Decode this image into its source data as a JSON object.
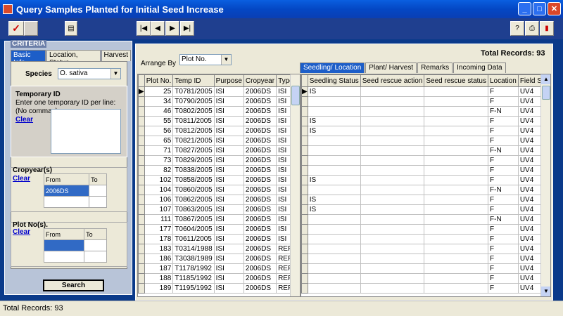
{
  "window": {
    "title": "Query Samples Planted for Initial Seed Increase"
  },
  "criteria": {
    "legend": "CRITERIA",
    "tabs": [
      "Basic Info",
      "Location, Status",
      "Harvest"
    ],
    "species_label": "Species",
    "species_value": "O. sativa",
    "temp_id": {
      "title": "Temporary ID",
      "hint1": "Enter one temporary ID per line:",
      "hint2": "(No commas)",
      "clear": "Clear"
    },
    "cropyear": {
      "title": "Cropyear(s)",
      "clear": "Clear",
      "from": "From",
      "to": "To",
      "from_value": "2006DS"
    },
    "plotno": {
      "title": "Plot No(s).",
      "clear": "Clear",
      "from": "From",
      "to": "To"
    },
    "search": "Search"
  },
  "results": {
    "arrange_by_label": "Arrange By",
    "arrange_by_value": "Plot No.",
    "total_records": "Total Records: 93",
    "tabs": [
      "Seedling/ Location",
      "Plant/ Harvest",
      "Remarks",
      "Incoming Data"
    ],
    "left_columns": [
      "Plot No.",
      "Temp ID",
      "Purpose",
      "Cropyear",
      "Type"
    ],
    "right_columns": [
      "Seedling Status",
      "Seed rescue action",
      "Seed rescue status",
      "Location",
      "Field Site"
    ],
    "rows": [
      [
        "25",
        "T0781/2005",
        "ISI",
        "2006DS",
        "ISI",
        "IS",
        "",
        "",
        "F",
        "UV4"
      ],
      [
        "34",
        "T0790/2005",
        "ISI",
        "2006DS",
        "ISI",
        "",
        "",
        "",
        "F",
        "UV4"
      ],
      [
        "46",
        "T0802/2005",
        "ISI",
        "2006DS",
        "ISI",
        "",
        "",
        "",
        "F-N",
        "UV4"
      ],
      [
        "55",
        "T0811/2005",
        "ISI",
        "2006DS",
        "ISI",
        "IS",
        "",
        "",
        "F",
        "UV4"
      ],
      [
        "56",
        "T0812/2005",
        "ISI",
        "2006DS",
        "ISI",
        "IS",
        "",
        "",
        "F",
        "UV4"
      ],
      [
        "65",
        "T0821/2005",
        "ISI",
        "2006DS",
        "ISI",
        "",
        "",
        "",
        "F",
        "UV4"
      ],
      [
        "71",
        "T0827/2005",
        "ISI",
        "2006DS",
        "ISI",
        "",
        "",
        "",
        "F-N",
        "UV4"
      ],
      [
        "73",
        "T0829/2005",
        "ISI",
        "2006DS",
        "ISI",
        "",
        "",
        "",
        "F",
        "UV4"
      ],
      [
        "82",
        "T0838/2005",
        "ISI",
        "2006DS",
        "ISI",
        "",
        "",
        "",
        "F",
        "UV4"
      ],
      [
        "102",
        "T0858/2005",
        "ISI",
        "2006DS",
        "ISI",
        "IS",
        "",
        "",
        "F",
        "UV4"
      ],
      [
        "104",
        "T0860/2005",
        "ISI",
        "2006DS",
        "ISI",
        "",
        "",
        "",
        "F-N",
        "UV4"
      ],
      [
        "106",
        "T0862/2005",
        "ISI",
        "2006DS",
        "ISI",
        "IS",
        "",
        "",
        "F",
        "UV4"
      ],
      [
        "107",
        "T0863/2005",
        "ISI",
        "2006DS",
        "ISI",
        "IS",
        "",
        "",
        "F",
        "UV4"
      ],
      [
        "111",
        "T0867/2005",
        "ISI",
        "2006DS",
        "ISI",
        "",
        "",
        "",
        "F-N",
        "UV4"
      ],
      [
        "177",
        "T0604/2005",
        "ISI",
        "2006DS",
        "ISI",
        "",
        "",
        "",
        "F",
        "UV4"
      ],
      [
        "178",
        "T0611/2005",
        "ISI",
        "2006DS",
        "ISI",
        "",
        "",
        "",
        "F",
        "UV4"
      ],
      [
        "183",
        "T0314/1988",
        "ISI",
        "2006DS",
        "REP",
        "",
        "",
        "",
        "F",
        "UV4"
      ],
      [
        "186",
        "T3038/1989",
        "ISI",
        "2006DS",
        "REP",
        "",
        "",
        "",
        "F",
        "UV4"
      ],
      [
        "187",
        "T1178/1992",
        "ISI",
        "2006DS",
        "REP",
        "",
        "",
        "",
        "F",
        "UV4"
      ],
      [
        "188",
        "T1185/1992",
        "ISI",
        "2006DS",
        "REP",
        "",
        "",
        "",
        "F",
        "UV4"
      ],
      [
        "189",
        "T1195/1992",
        "ISI",
        "2006DS",
        "REP",
        "",
        "",
        "",
        "F",
        "UV4"
      ]
    ]
  },
  "status_bar": "Total Records: 93",
  "colors": {
    "titlebar": "#0447c4",
    "toolbar": "#1f3f8f",
    "main_bg": "#0a3a8a",
    "active_tab": "#1d5ec8"
  }
}
